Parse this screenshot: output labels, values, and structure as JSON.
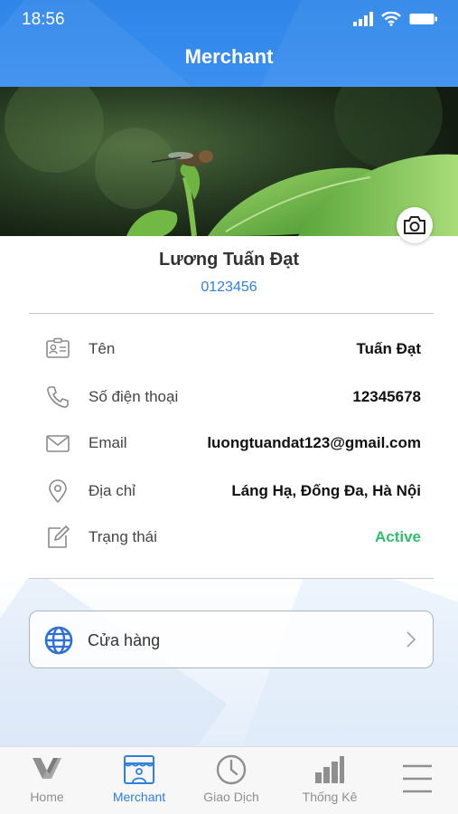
{
  "status_bar": {
    "time": "18:56"
  },
  "header": {
    "title": "Merchant"
  },
  "profile": {
    "name": "Lương Tuấn Đạt",
    "id": "0123456"
  },
  "info_rows": [
    {
      "icon": "id-card-icon",
      "label": "Tên",
      "value": "Tuấn Đạt"
    },
    {
      "icon": "phone-icon",
      "label": "Số điện thoại",
      "value": "12345678"
    },
    {
      "icon": "envelope-icon",
      "label": "Email",
      "value": "luongtuandat123@gmail.com"
    },
    {
      "icon": "location-pin-icon",
      "label": "Địa chỉ",
      "value": "Láng Hạ, Đống Đa, Hà Nội"
    },
    {
      "icon": "edit-icon",
      "label": "Trạng thái",
      "value": "Active"
    }
  ],
  "store_card": {
    "icon": "globe-icon",
    "label": "Cửa hàng"
  },
  "tabs": [
    {
      "label": "Home",
      "icon": "home-logo-icon",
      "active": false
    },
    {
      "label": "Merchant",
      "icon": "store-icon",
      "active": true
    },
    {
      "label": "Giao Dịch",
      "icon": "clock-icon",
      "active": false
    },
    {
      "label": "Thống Kê",
      "icon": "bar-chart-icon",
      "active": false
    },
    {
      "label": "",
      "icon": "menu-icon",
      "active": false
    }
  ],
  "colors": {
    "header_blue": "#2f86e8",
    "accent_blue": "#2f7fe0",
    "status_active": "#2ebf6d",
    "tab_inactive": "#8f8f8f"
  }
}
